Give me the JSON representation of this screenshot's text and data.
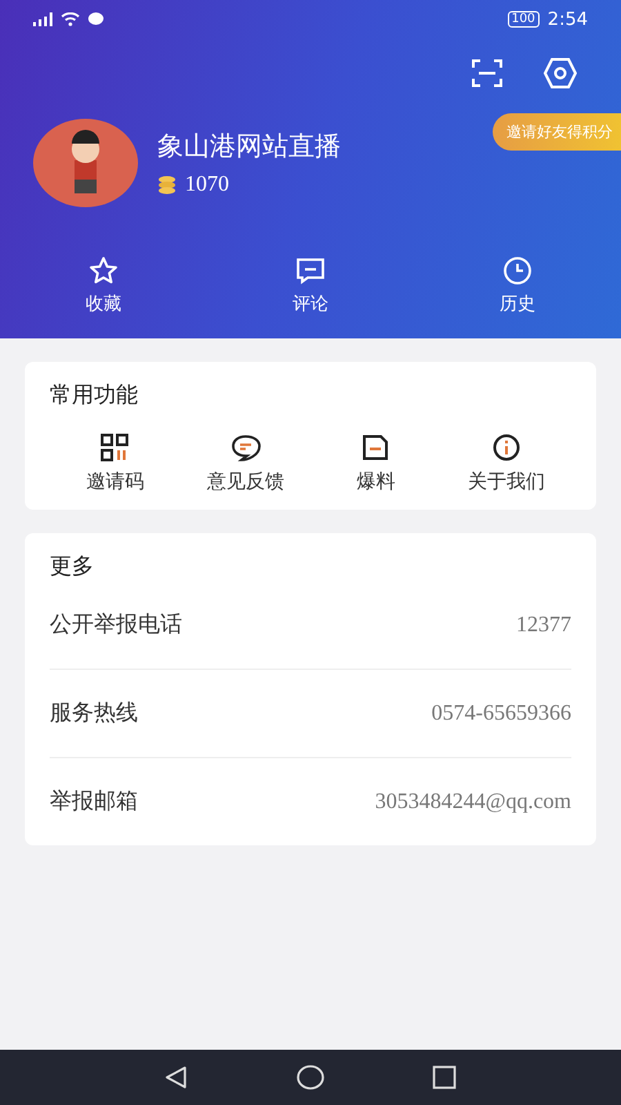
{
  "status_bar": {
    "battery": "100",
    "time": "2:54"
  },
  "profile": {
    "name": "象山港网站直播",
    "points": "1070",
    "invite_badge": "邀请好友得积分"
  },
  "tabs": [
    {
      "label": "收藏",
      "kind": "star"
    },
    {
      "label": "评论",
      "kind": "comment"
    },
    {
      "label": "历史",
      "kind": "clock"
    }
  ],
  "common": {
    "title": "常用功能",
    "items": [
      {
        "label": "邀请码",
        "kind": "qr"
      },
      {
        "label": "意见反馈",
        "kind": "feedback"
      },
      {
        "label": "爆料",
        "kind": "note"
      },
      {
        "label": "关于我们",
        "kind": "info"
      }
    ]
  },
  "more": {
    "title": "更多",
    "rows": [
      {
        "label": "公开举报电话",
        "value": "12377"
      },
      {
        "label": "服务热线",
        "value": "0574-65659366"
      },
      {
        "label": "举报邮箱",
        "value": "3053484244@qq.com"
      }
    ]
  }
}
